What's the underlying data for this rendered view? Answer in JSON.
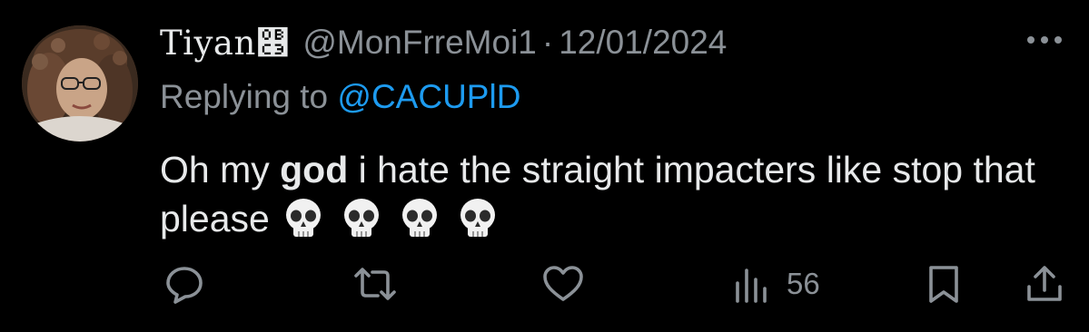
{
  "tweet": {
    "display_name": "Tiyan",
    "name_symbol": "௃",
    "handle": "@MonFrreMoi1",
    "separator": "·",
    "date": "12/01/2024",
    "replying_prefix": "Replying to",
    "replying_to": "@CACUPlD",
    "text_part1": "Oh my ",
    "text_bold": "god",
    "text_part2": " i hate the straight impacters like stop that please",
    "emoji": [
      "skull",
      "skull",
      "skull",
      "skull"
    ]
  },
  "actions": {
    "reply_icon": "reply-icon",
    "retweet_icon": "retweet-icon",
    "like_icon": "heart-icon",
    "views_icon": "views-chart-icon",
    "views_count": "56",
    "bookmark_icon": "bookmark-icon",
    "share_icon": "share-icon"
  },
  "colors": {
    "background": "#000000",
    "primary_text": "#e7e9ea",
    "secondary_text": "#8b9197",
    "link": "#1d9bf0"
  }
}
